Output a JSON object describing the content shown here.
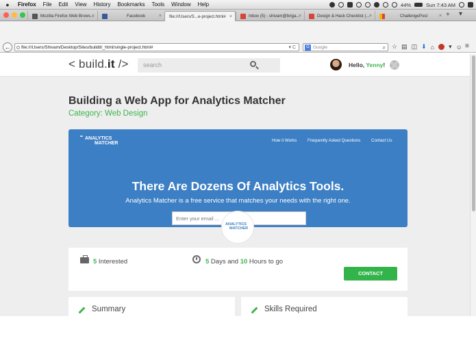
{
  "menubar": {
    "apple": "",
    "items": [
      "Firefox",
      "File",
      "Edit",
      "View",
      "History",
      "Bookmarks",
      "Tools",
      "Window",
      "Help"
    ],
    "battery": "44%",
    "clock": "Sun 7:43 AM"
  },
  "tabs": [
    {
      "label": "Mozilla Firefox Web Brows...",
      "favicon_color": "#555555"
    },
    {
      "label": "Facebook",
      "favicon_color": "#3b5998"
    },
    {
      "label": "file:///Users/S...e-project.html#",
      "favicon_color": "#ffffff"
    },
    {
      "label": "Inbox (5) - shivam@briga...",
      "favicon_color": "#d44638"
    },
    {
      "label": "Design & Hack Checklist (...",
      "favicon_color": "#d44638"
    },
    {
      "label": "ChallengePost",
      "favicon_color": "#f4b400"
    }
  ],
  "navbar": {
    "back": "←",
    "url": "file:///Users/Shivam/Desktop/Sites/buildit/_html/single-project.html#",
    "search_engine": "G",
    "search_placeholder": "Google",
    "menu_icon": "≡"
  },
  "site": {
    "logo_prefix": "< build.",
    "logo_bold": "it",
    "logo_suffix": " />",
    "search_placeholder": "search",
    "hello": "Hello, ",
    "user_name": "Yenny",
    "hello_suffix": "!"
  },
  "project": {
    "title": "Building a Web App for Analytics Matcher",
    "category": "Category: Web Design"
  },
  "hero": {
    "logo_line1": "ANALYTICS",
    "logo_line2": "MATCHER",
    "nav": [
      "How it Works",
      "Frequently Asked Questions",
      "Contact Us"
    ],
    "headline": "There Are Dozens Of Analytics Tools.",
    "subtitle": "Analytics Matcher is a free service that matches your needs with the right one.",
    "email_placeholder": "Enter your email ..."
  },
  "stats": {
    "interested_count": "5",
    "interested_label": " Interested",
    "days": "5",
    "days_label": " Days and ",
    "hours": "10",
    "hours_label": " Hours to go",
    "contact_label": "CONTACT"
  },
  "sections": {
    "summary": "Summary",
    "skills": "Skills Required"
  },
  "colors": {
    "accent_green": "#3fb44e",
    "hero_blue": "#3d7fc4",
    "page_bg": "#eeeeee"
  }
}
